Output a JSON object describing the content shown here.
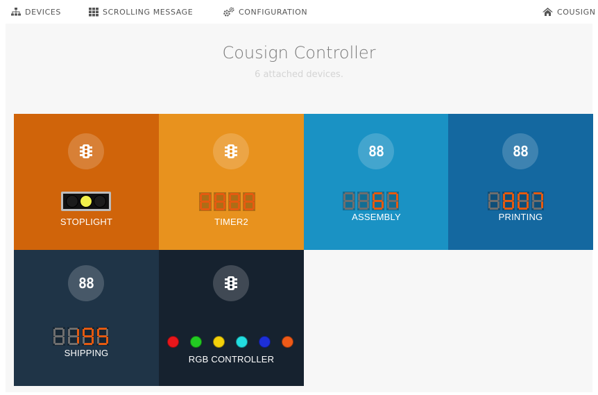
{
  "nav": {
    "devices": "DEVICES",
    "scrolling_message": "SCROLLING MESSAGE",
    "configuration": "CONFIGURATION",
    "home": "COUSIGN"
  },
  "header": {
    "title": "Cousign Controller",
    "subtitle": "6 attached devices."
  },
  "colors": {
    "stoplight": "#d0640a",
    "timer2": "#e8921e",
    "assembly": "#1a92c4",
    "printing": "#1468a0",
    "shipping": "#1f3447",
    "rgb_controller": "#16222f",
    "segment_on": "#e55a10",
    "segment_off": "#6e6e6e"
  },
  "devices": [
    {
      "name": "STOPLIGHT",
      "icon": "traffic-light-icon",
      "display": "stoplight",
      "lights": [
        "#1c1c1c",
        "#f1f04a",
        "#1c1c1c"
      ]
    },
    {
      "name": "TIMER2",
      "icon": "traffic-light-icon",
      "display": "segments",
      "digits": [
        "8",
        "8",
        "8",
        "8"
      ],
      "lit": [
        true,
        true,
        true,
        true
      ]
    },
    {
      "name": "ASSEMBLY",
      "icon": "88-icon",
      "display": "segments",
      "digits": [
        "8",
        "8",
        "6",
        "7"
      ],
      "lit": [
        false,
        false,
        true,
        true
      ]
    },
    {
      "name": "PRINTING",
      "icon": "88-icon",
      "display": "segments",
      "digits": [
        "8",
        "8",
        "0",
        "7"
      ],
      "lit": [
        false,
        true,
        true,
        true
      ]
    },
    {
      "name": "SHIPPING",
      "icon": "88-icon",
      "display": "segments",
      "digits": [
        "8",
        "1",
        "9",
        "5"
      ],
      "lit": [
        false,
        true,
        true,
        true
      ]
    },
    {
      "name": "RGB CONTROLLER",
      "icon": "traffic-light-icon",
      "display": "rgb",
      "leds": [
        "#e8161b",
        "#22cc22",
        "#f3d10a",
        "#22dde0",
        "#1d2fd8",
        "#ee5a18"
      ]
    }
  ],
  "icon_text": "88"
}
